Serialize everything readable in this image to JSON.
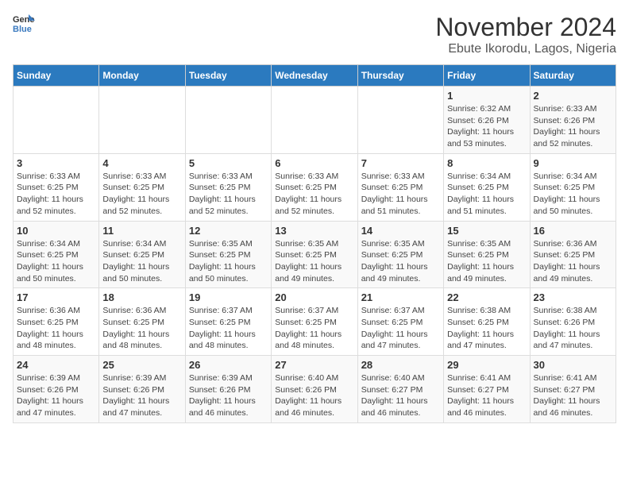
{
  "logo": {
    "general": "General",
    "blue": "Blue"
  },
  "title": "November 2024",
  "subtitle": "Ebute Ikorodu, Lagos, Nigeria",
  "weekdays": [
    "Sunday",
    "Monday",
    "Tuesday",
    "Wednesday",
    "Thursday",
    "Friday",
    "Saturday"
  ],
  "weeks": [
    [
      {
        "day": "",
        "info": ""
      },
      {
        "day": "",
        "info": ""
      },
      {
        "day": "",
        "info": ""
      },
      {
        "day": "",
        "info": ""
      },
      {
        "day": "",
        "info": ""
      },
      {
        "day": "1",
        "info": "Sunrise: 6:32 AM\nSunset: 6:26 PM\nDaylight: 11 hours and 53 minutes."
      },
      {
        "day": "2",
        "info": "Sunrise: 6:33 AM\nSunset: 6:26 PM\nDaylight: 11 hours and 52 minutes."
      }
    ],
    [
      {
        "day": "3",
        "info": "Sunrise: 6:33 AM\nSunset: 6:25 PM\nDaylight: 11 hours and 52 minutes."
      },
      {
        "day": "4",
        "info": "Sunrise: 6:33 AM\nSunset: 6:25 PM\nDaylight: 11 hours and 52 minutes."
      },
      {
        "day": "5",
        "info": "Sunrise: 6:33 AM\nSunset: 6:25 PM\nDaylight: 11 hours and 52 minutes."
      },
      {
        "day": "6",
        "info": "Sunrise: 6:33 AM\nSunset: 6:25 PM\nDaylight: 11 hours and 52 minutes."
      },
      {
        "day": "7",
        "info": "Sunrise: 6:33 AM\nSunset: 6:25 PM\nDaylight: 11 hours and 51 minutes."
      },
      {
        "day": "8",
        "info": "Sunrise: 6:34 AM\nSunset: 6:25 PM\nDaylight: 11 hours and 51 minutes."
      },
      {
        "day": "9",
        "info": "Sunrise: 6:34 AM\nSunset: 6:25 PM\nDaylight: 11 hours and 50 minutes."
      }
    ],
    [
      {
        "day": "10",
        "info": "Sunrise: 6:34 AM\nSunset: 6:25 PM\nDaylight: 11 hours and 50 minutes."
      },
      {
        "day": "11",
        "info": "Sunrise: 6:34 AM\nSunset: 6:25 PM\nDaylight: 11 hours and 50 minutes."
      },
      {
        "day": "12",
        "info": "Sunrise: 6:35 AM\nSunset: 6:25 PM\nDaylight: 11 hours and 50 minutes."
      },
      {
        "day": "13",
        "info": "Sunrise: 6:35 AM\nSunset: 6:25 PM\nDaylight: 11 hours and 49 minutes."
      },
      {
        "day": "14",
        "info": "Sunrise: 6:35 AM\nSunset: 6:25 PM\nDaylight: 11 hours and 49 minutes."
      },
      {
        "day": "15",
        "info": "Sunrise: 6:35 AM\nSunset: 6:25 PM\nDaylight: 11 hours and 49 minutes."
      },
      {
        "day": "16",
        "info": "Sunrise: 6:36 AM\nSunset: 6:25 PM\nDaylight: 11 hours and 49 minutes."
      }
    ],
    [
      {
        "day": "17",
        "info": "Sunrise: 6:36 AM\nSunset: 6:25 PM\nDaylight: 11 hours and 48 minutes."
      },
      {
        "day": "18",
        "info": "Sunrise: 6:36 AM\nSunset: 6:25 PM\nDaylight: 11 hours and 48 minutes."
      },
      {
        "day": "19",
        "info": "Sunrise: 6:37 AM\nSunset: 6:25 PM\nDaylight: 11 hours and 48 minutes."
      },
      {
        "day": "20",
        "info": "Sunrise: 6:37 AM\nSunset: 6:25 PM\nDaylight: 11 hours and 48 minutes."
      },
      {
        "day": "21",
        "info": "Sunrise: 6:37 AM\nSunset: 6:25 PM\nDaylight: 11 hours and 47 minutes."
      },
      {
        "day": "22",
        "info": "Sunrise: 6:38 AM\nSunset: 6:25 PM\nDaylight: 11 hours and 47 minutes."
      },
      {
        "day": "23",
        "info": "Sunrise: 6:38 AM\nSunset: 6:26 PM\nDaylight: 11 hours and 47 minutes."
      }
    ],
    [
      {
        "day": "24",
        "info": "Sunrise: 6:39 AM\nSunset: 6:26 PM\nDaylight: 11 hours and 47 minutes."
      },
      {
        "day": "25",
        "info": "Sunrise: 6:39 AM\nSunset: 6:26 PM\nDaylight: 11 hours and 47 minutes."
      },
      {
        "day": "26",
        "info": "Sunrise: 6:39 AM\nSunset: 6:26 PM\nDaylight: 11 hours and 46 minutes."
      },
      {
        "day": "27",
        "info": "Sunrise: 6:40 AM\nSunset: 6:26 PM\nDaylight: 11 hours and 46 minutes."
      },
      {
        "day": "28",
        "info": "Sunrise: 6:40 AM\nSunset: 6:27 PM\nDaylight: 11 hours and 46 minutes."
      },
      {
        "day": "29",
        "info": "Sunrise: 6:41 AM\nSunset: 6:27 PM\nDaylight: 11 hours and 46 minutes."
      },
      {
        "day": "30",
        "info": "Sunrise: 6:41 AM\nSunset: 6:27 PM\nDaylight: 11 hours and 46 minutes."
      }
    ]
  ]
}
